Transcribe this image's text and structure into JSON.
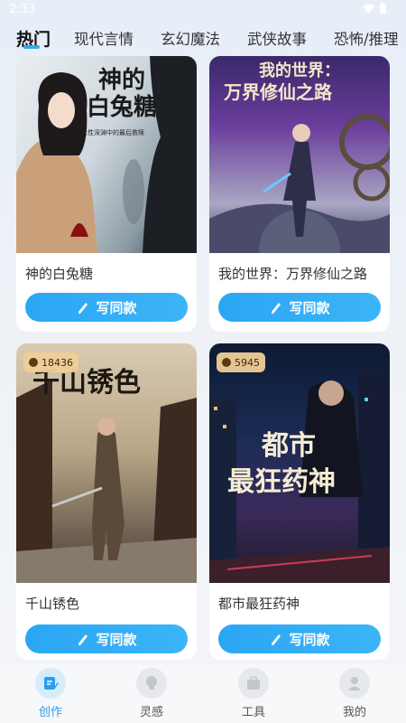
{
  "status_bar": {
    "time": "2:33"
  },
  "tabs": [
    {
      "label": "热门"
    },
    {
      "label": "现代言情"
    },
    {
      "label": "玄幻魔法"
    },
    {
      "label": "武侠故事"
    },
    {
      "label": "恐怖/推理"
    }
  ],
  "cards": [
    {
      "title": "神的白兔糖",
      "cover_title": "神的\n白兔糖",
      "cover_subtitle": "人性深渊中的最后救赎",
      "button_label": "写同款"
    },
    {
      "title": "我的世界：万界修仙之路",
      "cover_title_line1": "我的世界：",
      "cover_title_line2": "万界修仙之路",
      "button_label": "写同款"
    },
    {
      "title": "千山锈色",
      "cover_title": "千山锈色",
      "count": "18436",
      "button_label": "写同款"
    },
    {
      "title": "都市最狂药神",
      "cover_title_line1": "都市",
      "cover_title_line2": "最狂药神",
      "count": "5945",
      "button_label": "写同款"
    }
  ],
  "bottom_nav": [
    {
      "label": "创作",
      "icon": "pen-paper-icon",
      "active": true
    },
    {
      "label": "灵感",
      "icon": "lightbulb-icon"
    },
    {
      "label": "工具",
      "icon": "toolbox-icon"
    },
    {
      "label": "我的",
      "icon": "user-icon"
    }
  ],
  "colors": {
    "accent": "#2fa8f3",
    "background": "#eef2f7"
  }
}
